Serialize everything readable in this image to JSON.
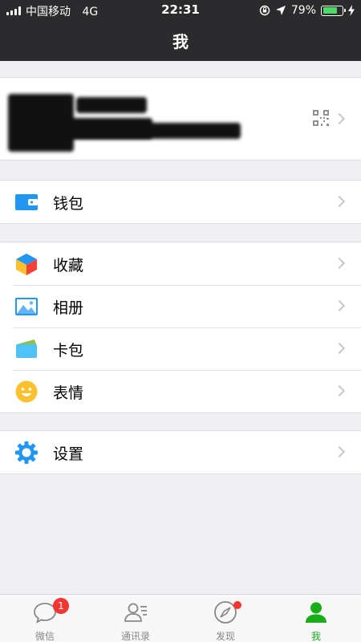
{
  "status_bar": {
    "carrier": "中国移动",
    "network": "4G",
    "time": "22:31",
    "battery_percent": "79%",
    "battery_level": 0.79
  },
  "nav": {
    "title": "我"
  },
  "menu": {
    "wallet": "钱包",
    "favorites": "收藏",
    "album": "相册",
    "cards": "卡包",
    "stickers": "表情",
    "settings": "设置"
  },
  "tabs": [
    {
      "label": "微信",
      "badge": "1"
    },
    {
      "label": "通讯录"
    },
    {
      "label": "发现"
    },
    {
      "label": "我"
    }
  ],
  "colors": {
    "accent": "#1aad19",
    "badge": "#f43530",
    "topbar": "#2b2b2d",
    "background": "#efeff4"
  }
}
